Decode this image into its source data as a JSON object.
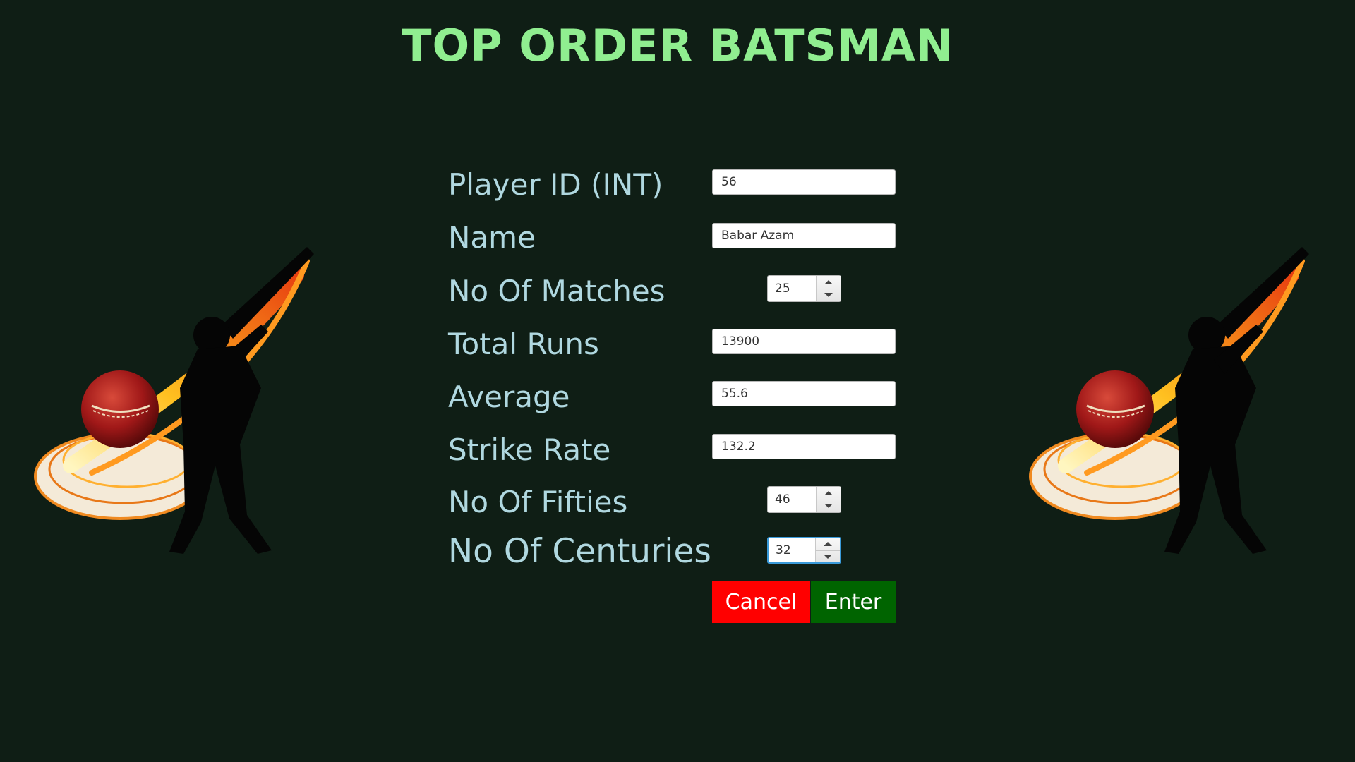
{
  "title": "TOP ORDER BATSMAN",
  "form": {
    "player_id": {
      "label": "Player ID (INT)",
      "value": "56"
    },
    "name": {
      "label": "Name",
      "value": "Babar Azam"
    },
    "matches": {
      "label": "No Of Matches",
      "value": "25"
    },
    "total_runs": {
      "label": "Total Runs",
      "value": "13900"
    },
    "average": {
      "label": "Average",
      "value": "55.6"
    },
    "strike_rate": {
      "label": "Strike Rate",
      "value": "132.2"
    },
    "fifties": {
      "label": "No Of Fifties",
      "value": "46"
    },
    "centuries": {
      "label": "No Of Centuries",
      "value": "32"
    }
  },
  "buttons": {
    "cancel": "Cancel",
    "enter": "Enter"
  },
  "colors": {
    "background": "#0f1e15",
    "title": "#90ee90",
    "label": "#b0d8e0",
    "cancel": "#ff0000",
    "enter": "#006400",
    "focus": "#3a9ad9"
  },
  "icons": {
    "decoration": "cricket-batsman-icon"
  }
}
